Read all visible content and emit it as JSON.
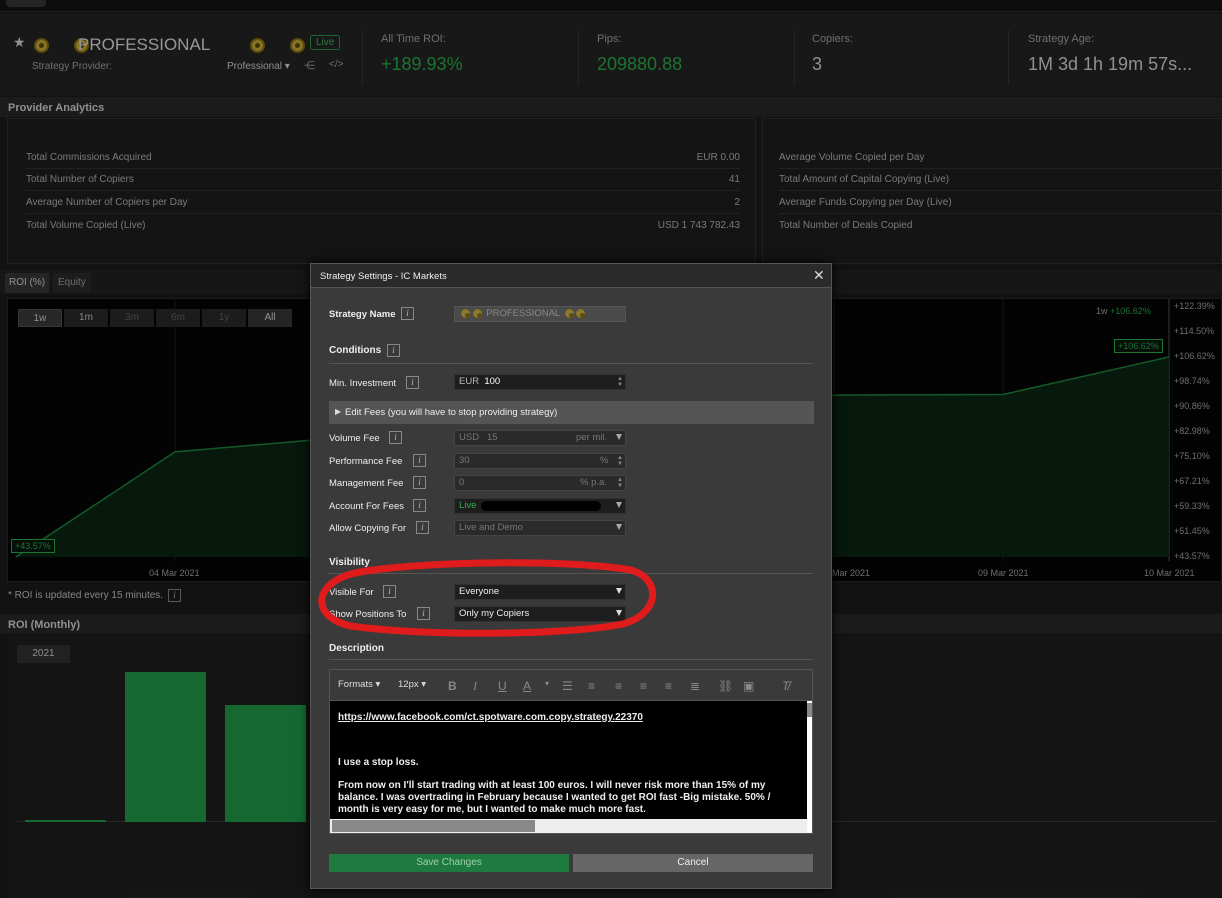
{
  "header": {
    "title": "PROFESSIONAL",
    "live_badge": "Live",
    "provider_label": "Strategy Provider:",
    "provider_value": "Professional",
    "stats": [
      {
        "label": "All Time ROI:",
        "value": "+189.93%",
        "color": "#2bb24c"
      },
      {
        "label": "Pips:",
        "value": "209880.88",
        "color": "#2bb24c"
      },
      {
        "label": "Copiers:",
        "value": "3",
        "color": "#dddddd"
      },
      {
        "label": "Strategy Age:",
        "value": "1M 3d 1h 19m 57s...",
        "color": "#dddddd"
      }
    ]
  },
  "analytics": {
    "title": "Provider Analytics",
    "left": [
      {
        "label": "Total Commissions Acquired",
        "value": "EUR 0.00"
      },
      {
        "label": "Total Number of Copiers",
        "value": "41"
      },
      {
        "label": "Average Number of Copiers per Day",
        "value": "2"
      },
      {
        "label": "Total Volume Copied (Live)",
        "value": "USD 1 743 782.43"
      }
    ],
    "right": [
      {
        "label": "Average Volume Copied per Day"
      },
      {
        "label": "Total Amount of Capital Copying (Live)"
      },
      {
        "label": "Average Funds Copying per Day (Live)"
      },
      {
        "label": "Total Number of Deals Copied"
      }
    ]
  },
  "roi_chart": {
    "tabs": [
      "ROI (%)",
      "Equity"
    ],
    "periods": [
      "1w",
      "1m",
      "3m",
      "6m",
      "1y",
      "All"
    ],
    "period_label": "1w",
    "period_value": "+106.62%",
    "current_badge": "+106.62%",
    "start_badge": "+43.57%",
    "note": "* ROI is updated every 15 minutes."
  },
  "roi_monthly": {
    "title": "ROI (Monthly)",
    "year": "2021"
  },
  "chart_data": {
    "type": "area",
    "x": [
      "04 Mar 2021",
      "09 Mar 2021",
      "10 Mar 2021"
    ],
    "yticks": [
      "+122.39%",
      "+114.50%",
      "+106.62%",
      "+98.74%",
      "+90.86%",
      "+82.98%",
      "+75.10%",
      "+67.21%",
      "+59.33%",
      "+51.45%",
      "+43.57%"
    ],
    "ylim": [
      43.57,
      122.39
    ],
    "xlabels": [
      "04 Mar 2021",
      "Mar 2021",
      "09 Mar 2021",
      "10 Mar 2021"
    ],
    "series": [
      {
        "name": "ROI",
        "values": [
          43.57,
          76.7,
          94.6,
          94.8,
          106.62
        ]
      }
    ]
  },
  "modal": {
    "title": "Strategy Settings - IC Markets",
    "strategy_name_label": "Strategy Name",
    "strategy_name_value": "PROFESSIONAL",
    "conditions": "Conditions",
    "min_investment_label": "Min. Investment",
    "min_currency": "EUR",
    "min_value": "100",
    "edit_fees": "Edit Fees (you will have to stop providing strategy)",
    "volume_fee_label": "Volume Fee",
    "volume_currency": "USD",
    "volume_value": "15",
    "volume_unit": "per mil.",
    "performance_fee_label": "Performance Fee",
    "performance_value": "30",
    "performance_unit": "%",
    "management_fee_label": "Management Fee",
    "management_value": "0",
    "management_unit": "% p.a.",
    "account_fees_label": "Account For Fees",
    "account_value": "Live",
    "allow_copying_label": "Allow Copying For",
    "allow_copying_value": "Live and Demo",
    "visibility": "Visibility",
    "visible_for_label": "Visible For",
    "visible_for_value": "Everyone",
    "show_positions_label": "Show Positions To",
    "show_positions_value": "Only my Copiers",
    "description": "Description",
    "toolbar_formats": "Formats",
    "toolbar_size": "12px",
    "desc_link": "https://www.facebook.com/ct.spotware.com.copy.strategy.22370",
    "desc_p1": "I use a stop loss.",
    "desc_p2": "From now on  I'll start trading with at least 100 euros. I will never risk more than 15% of my balance. I was overtrading in February because I wanted to get ROI fast -Big mistake. 50% / month is very easy for me, but I wanted to make much more fast.",
    "save": "Save Changes",
    "cancel": "Cancel"
  }
}
